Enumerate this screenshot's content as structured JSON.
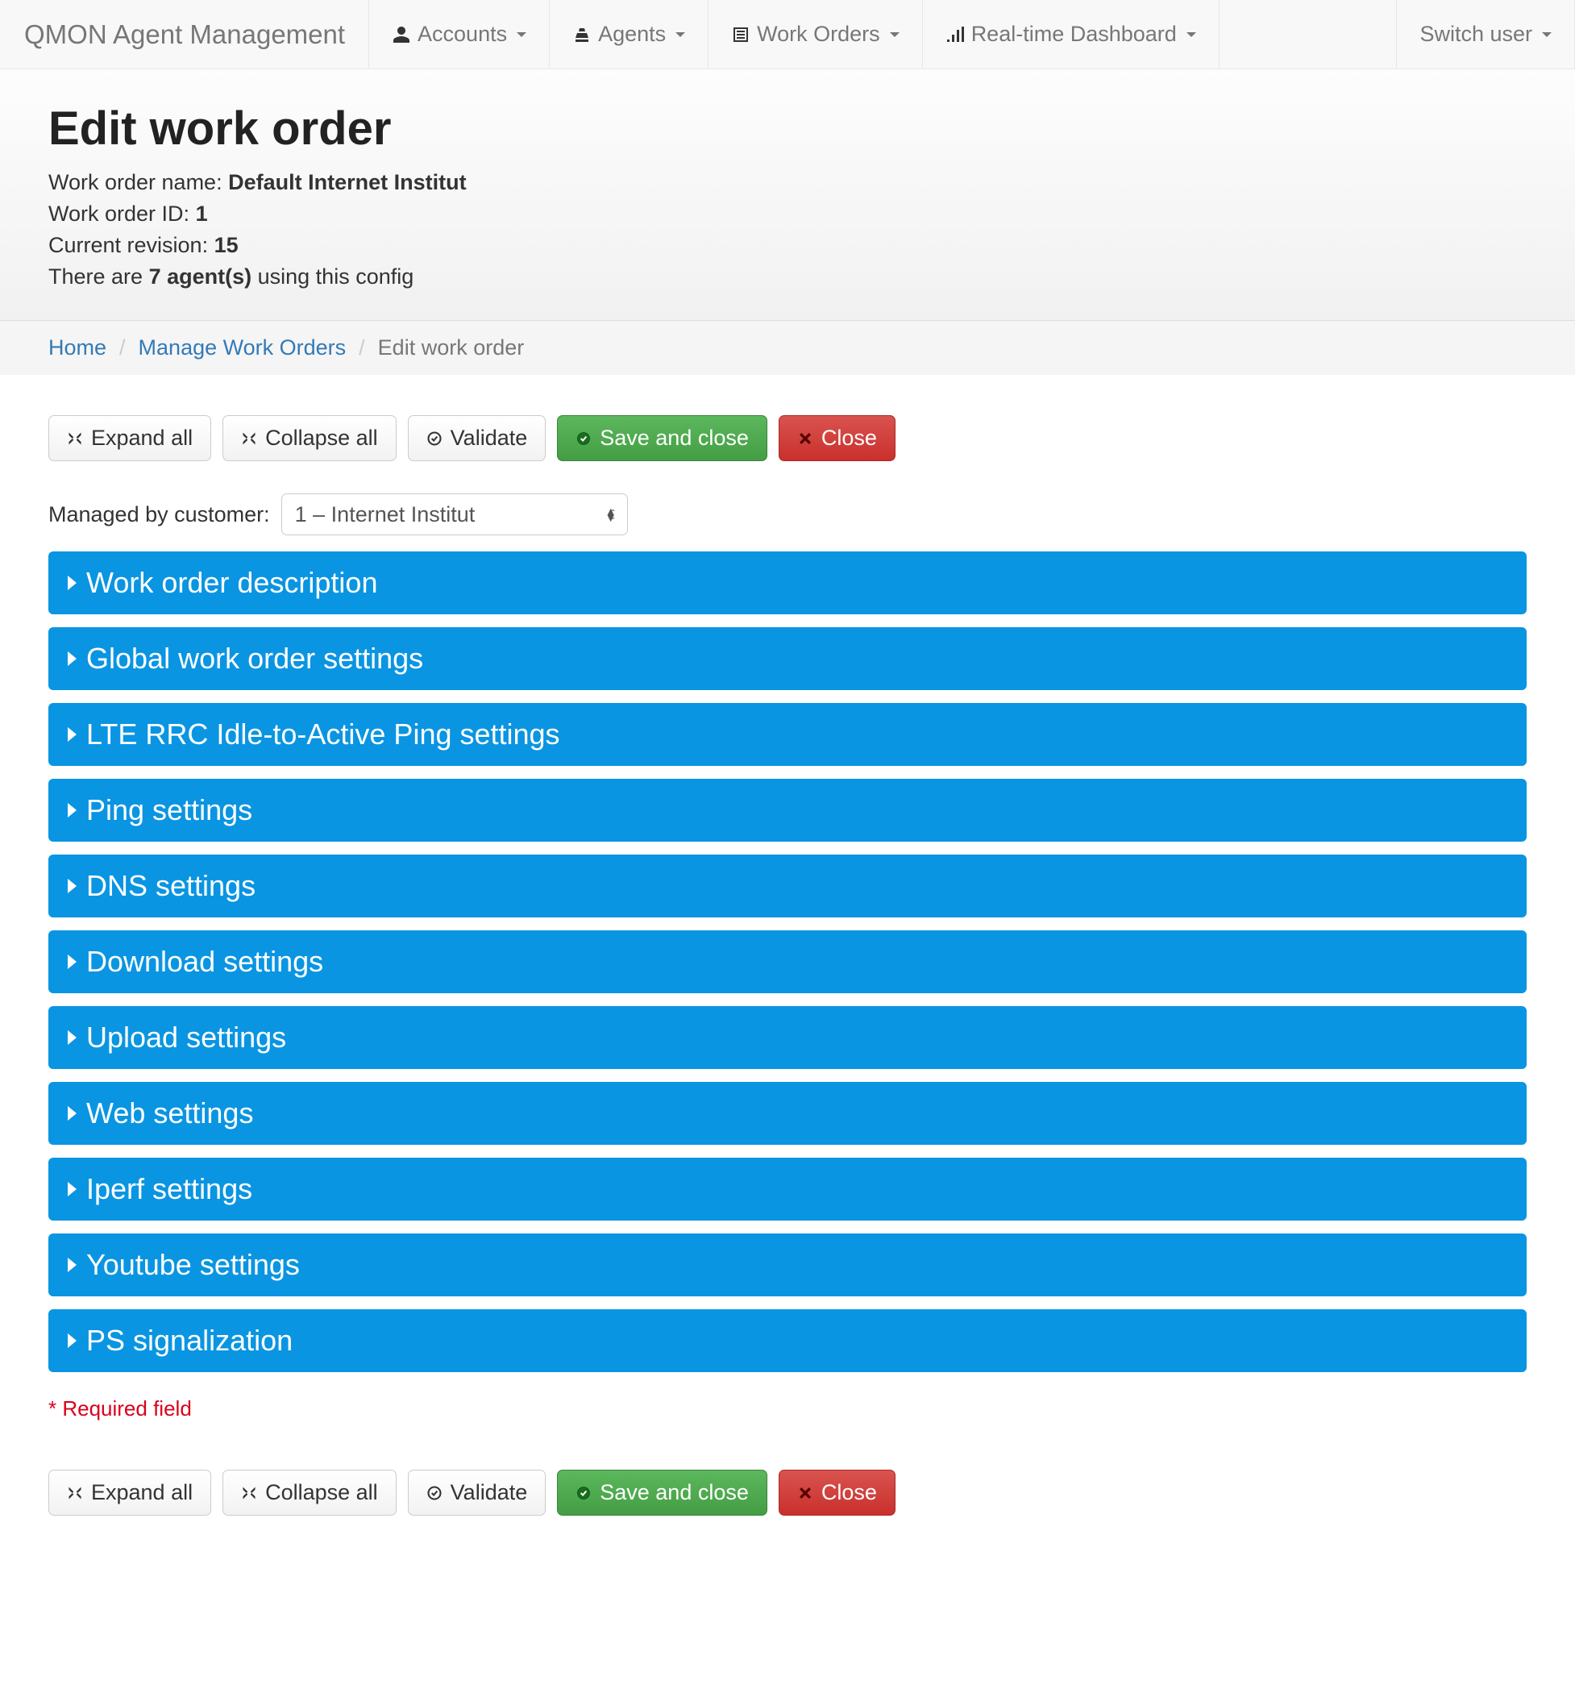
{
  "navbar": {
    "brand": "QMON Agent Management",
    "items": [
      {
        "label": "Accounts",
        "icon": "user"
      },
      {
        "label": "Agents",
        "icon": "agent"
      },
      {
        "label": "Work Orders",
        "icon": "list"
      },
      {
        "label": "Real-time Dashboard",
        "icon": "signal"
      }
    ],
    "switch_user": "Switch user"
  },
  "header": {
    "title": "Edit work order",
    "name_label": "Work order name:",
    "name_value": "Default Internet Institut",
    "id_label": "Work order ID:",
    "id_value": "1",
    "revision_label": "Current revision:",
    "revision_value": "15",
    "agents_prefix": "There are",
    "agents_count": "7 agent(s)",
    "agents_suffix": "using this config"
  },
  "breadcrumb": {
    "home": "Home",
    "manage": "Manage Work Orders",
    "current": "Edit work order"
  },
  "toolbar": {
    "expand_all": "Expand all",
    "collapse_all": "Collapse all",
    "validate": "Validate",
    "save_close": "Save and close",
    "close": "Close"
  },
  "managed_by": {
    "label": "Managed by customer:",
    "selected": "1 – Internet Institut"
  },
  "panels": [
    "Work order description",
    "Global work order settings",
    "LTE RRC Idle-to-Active Ping settings",
    "Ping settings",
    "DNS settings",
    "Download settings",
    "Upload settings",
    "Web settings",
    "Iperf settings",
    "Youtube settings",
    "PS signalization"
  ],
  "required_note": "* Required field"
}
